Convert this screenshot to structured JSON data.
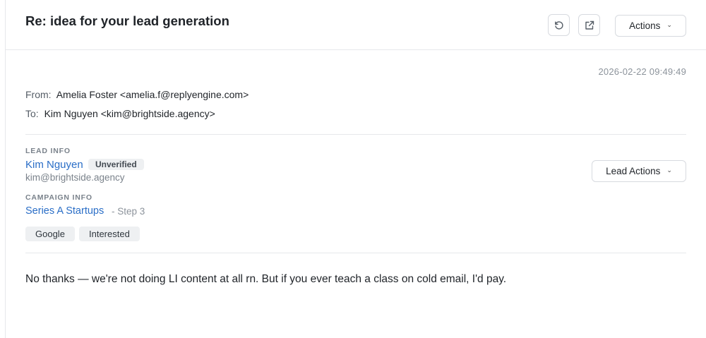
{
  "email": {
    "subject": "Re: idea for your lead generation",
    "timestamp": "2026-02-22 09:49:49",
    "from_label": "From:",
    "from_value": "Amelia Foster <amelia.f@replyengine.com>",
    "to_label": "To:",
    "to_value": "Kim Nguyen <kim@brightside.agency>",
    "body": "No thanks — we're not doing LI content at all rn. But if you ever teach a class on cold email, I'd pay."
  },
  "toolbar": {
    "refresh_icon": "refresh-icon",
    "open_icon": "external-link-icon",
    "actions_label": "Actions"
  },
  "lead": {
    "section_label": "LEAD INFO",
    "name": "Kim Nguyen",
    "status_badge": "Unverified",
    "email": "kim@brightside.agency",
    "actions_label": "Lead Actions"
  },
  "campaign": {
    "section_label": "CAMPAIGN INFO",
    "name": "Series A Startups",
    "step": "- Step 3"
  },
  "tags": [
    "Google",
    "Interested"
  ],
  "colors": {
    "link": "#2a6ec7",
    "muted": "#8c939b",
    "badge_bg": "#eef0f2",
    "border": "#d7dadf"
  }
}
